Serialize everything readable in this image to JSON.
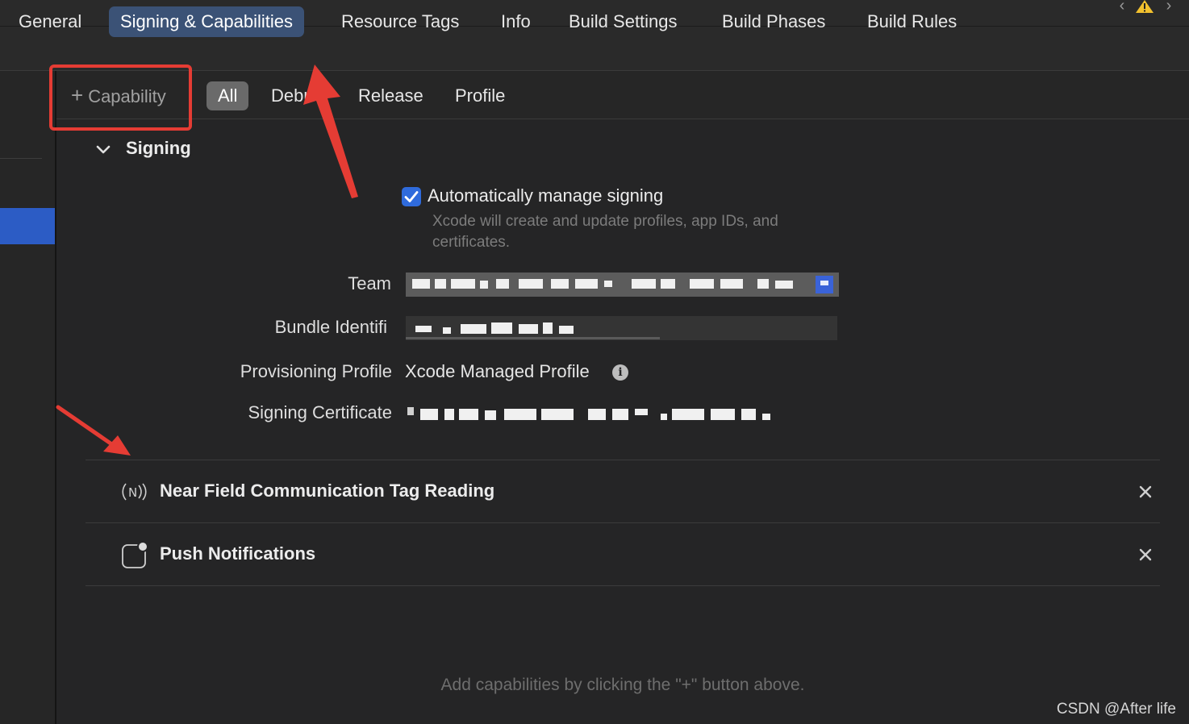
{
  "tabs": [
    {
      "label": "General"
    },
    {
      "label": "Signing & Capabilities"
    },
    {
      "label": "Resource Tags"
    },
    {
      "label": "Info"
    },
    {
      "label": "Build Settings"
    },
    {
      "label": "Build Phases"
    },
    {
      "label": "Build Rules"
    }
  ],
  "filterbar": {
    "add_capability": "Capability",
    "filters": [
      {
        "label": "All"
      },
      {
        "label": "Debu"
      },
      {
        "label": "Release"
      },
      {
        "label": "Profile"
      }
    ]
  },
  "signing": {
    "title": "Signing",
    "auto_manage_label": "Automatically manage signing",
    "auto_manage_checked": true,
    "auto_manage_desc": "Xcode will create and update profiles, app IDs, and certificates.",
    "team_label": "Team",
    "bundle_label": "Bundle Identifi",
    "profile_label": "Provisioning Profile",
    "profile_value": "Xcode Managed Profile",
    "certificate_label": "Signing Certificate"
  },
  "capabilities": [
    {
      "name": "Near Field Communication Tag Reading",
      "icon": "nfc-icon"
    },
    {
      "name": "Push Notifications",
      "icon": "notification-badge-icon"
    }
  ],
  "hint": "Add capabilities by clicking the \"+\" button above.",
  "watermark": "CSDN @After life",
  "colors": {
    "accent": "#3b5276",
    "checkbox": "#2f6bdc",
    "sidebar_selection": "#2c5cc5",
    "annotation_red": "#e53c34"
  }
}
